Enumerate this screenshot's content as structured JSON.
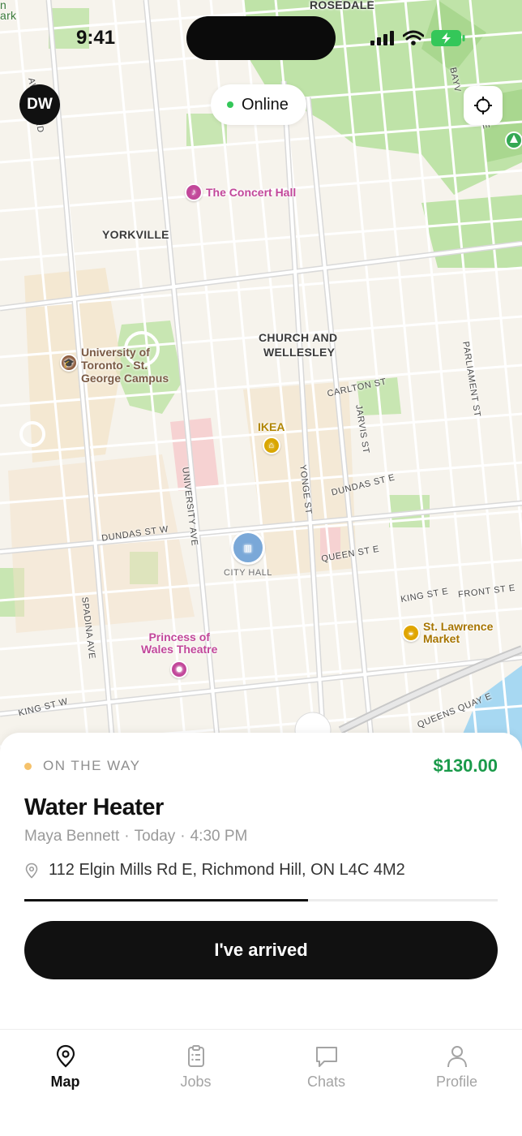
{
  "status_bar": {
    "time": "9:41"
  },
  "map": {
    "neighborhoods": [
      "ROSEDALE",
      "YORKVILLE",
      "CHURCH AND",
      "WELLESLEY"
    ],
    "corner_fragment": [
      "n",
      "ark"
    ],
    "streets": [
      "AVENUE RD",
      "BAYV",
      "E",
      "CARLTON ST",
      "PARLIAMENT ST",
      "JARVIS ST",
      "YONGE ST",
      "UNIVERSITY AVE",
      "DUNDAS ST E",
      "DUNDAS ST W",
      "QUEEN ST E",
      "KING ST E",
      "FRONT ST E",
      "SPADINA AVE",
      "KING ST W",
      "QUEENS QUAY E"
    ],
    "pois": [
      {
        "name": "The Concert Hall",
        "color": "#c2479a"
      },
      {
        "name": "University of Toronto - St. George Campus",
        "lines": [
          "University of",
          "Toronto - St.",
          "George Campus"
        ],
        "color": "#8b5a3c"
      },
      {
        "name": "IKEA",
        "color": "#d9a600"
      },
      {
        "name": "CITY HALL",
        "color": "#6c6c6c"
      },
      {
        "name": "Princess of Wales Theatre",
        "lines": [
          "Princess of",
          "Wales Theatre"
        ],
        "color": "#c2479a"
      },
      {
        "name": "St. Lawrence Market",
        "lines": [
          "St. Lawrence",
          "Market"
        ],
        "color": "#d99a00"
      }
    ]
  },
  "header": {
    "avatar_initials": "DW",
    "online_status": "Online",
    "online_color": "#34c759"
  },
  "job": {
    "status": "ON THE WAY",
    "status_color": "#f5c26b",
    "price": "$130.00",
    "price_color": "#1a9a4a",
    "title": "Water Heater",
    "customer": "Maya Bennett",
    "day": "Today",
    "time": "4:30 PM",
    "separator": "·",
    "address": "112 Elgin Mills Rd E, Richmond Hill, ON L4C 4M2",
    "progress": 0.6,
    "action_label": "I've arrived"
  },
  "tabs": [
    {
      "label": "Map",
      "icon": "map-pin-icon",
      "active": true
    },
    {
      "label": "Jobs",
      "icon": "clipboard-icon",
      "active": false
    },
    {
      "label": "Chats",
      "icon": "chat-bubble-icon",
      "active": false
    },
    {
      "label": "Profile",
      "icon": "person-icon",
      "active": false
    }
  ]
}
